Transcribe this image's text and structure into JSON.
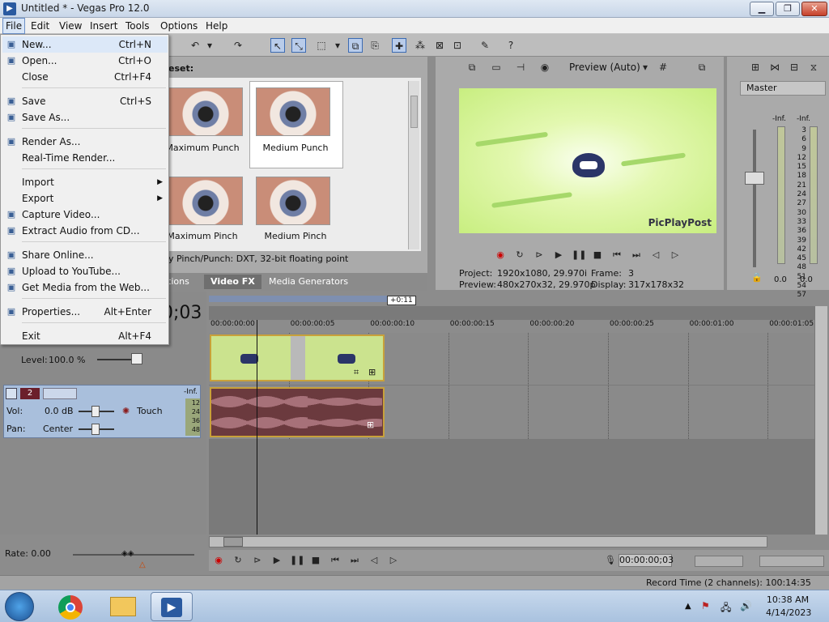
{
  "window": {
    "title": "Untitled * - Vegas Pro 12.0",
    "app_icon": "vegas-icon"
  },
  "menubar": [
    "File",
    "Edit",
    "View",
    "Insert",
    "Tools",
    "Options",
    "Help"
  ],
  "file_menu": {
    "items": [
      {
        "label": "New...",
        "shortcut": "Ctrl+N",
        "icon": "new-file-icon"
      },
      {
        "label": "Open...",
        "shortcut": "Ctrl+O",
        "icon": "open-folder-icon"
      },
      {
        "label": "Close",
        "shortcut": "Ctrl+F4",
        "icon": ""
      },
      {
        "label": "Save",
        "shortcut": "Ctrl+S",
        "icon": "save-icon"
      },
      {
        "label": "Save As...",
        "shortcut": "",
        "icon": "save-as-icon"
      },
      {
        "label": "Render As...",
        "shortcut": "",
        "icon": "render-icon"
      },
      {
        "label": "Real-Time Render...",
        "shortcut": "",
        "icon": ""
      },
      {
        "label": "Import",
        "shortcut": "",
        "icon": ""
      },
      {
        "label": "Export",
        "shortcut": "",
        "icon": ""
      },
      {
        "label": "Capture Video...",
        "shortcut": "",
        "icon": "capture-icon"
      },
      {
        "label": "Extract Audio from CD...",
        "shortcut": "",
        "icon": "cd-icon"
      },
      {
        "label": "Share Online...",
        "shortcut": "",
        "icon": "share-icon"
      },
      {
        "label": "Upload to YouTube...",
        "shortcut": "",
        "icon": "youtube-icon"
      },
      {
        "label": "Get Media from the Web...",
        "shortcut": "",
        "icon": "web-icon"
      },
      {
        "label": "Properties...",
        "shortcut": "Alt+Enter",
        "icon": "properties-icon"
      },
      {
        "label": "Exit",
        "shortcut": "Alt+F4",
        "icon": ""
      }
    ]
  },
  "fx_panel": {
    "header": "eset:",
    "presets": [
      "Maximum Punch",
      "Medium Punch",
      "Maximum Pinch",
      "Medium Pinch"
    ],
    "description": "y Pinch/Punch: DXT, 32-bit floating point",
    "tabs": [
      "itions",
      "Video FX",
      "Media Generators"
    ]
  },
  "preview": {
    "mode": "Preview (Auto)",
    "watermark": "PicPlayPost",
    "project_label": "Project:",
    "project_value": "1920x1080, 29.970i",
    "preview_label": "Preview:",
    "preview_value": "480x270x32, 29.970p",
    "frame_label": "Frame:",
    "frame_value": "3",
    "display_label": "Display:",
    "display_value": "317x178x32"
  },
  "master": {
    "label": "Master",
    "left_peak": "-Inf.",
    "right_peak": "-Inf.",
    "scale": [
      "3",
      "6",
      "9",
      "12",
      "15",
      "18",
      "21",
      "24",
      "27",
      "30",
      "33",
      "36",
      "39",
      "42",
      "45",
      "48",
      "51",
      "54",
      "57"
    ],
    "left_value": "0.0",
    "right_value": "0.0"
  },
  "timeline": {
    "time_display": "0;03",
    "region_marker": "+0:11",
    "ruler_ticks": [
      "00:00:00:00",
      "00:00:00:05",
      "00:00:00:10",
      "00:00:00:15",
      "00:00:00:20",
      "00:00:00:25",
      "00:00:01:00",
      "00:00:01:05"
    ],
    "track1": {
      "level_label": "Level:",
      "level_value": "100.0 %"
    },
    "track2": {
      "number": "2",
      "vol_label": "Vol:",
      "vol_value": "0.0 dB",
      "pan_label": "Pan:",
      "pan_value": "Center",
      "automation": "Touch",
      "peak": "-Inf.",
      "scale": [
        "12",
        "24",
        "36",
        "48"
      ]
    }
  },
  "transport": {
    "rate_label": "Rate: 0.00",
    "time": "00:00:00;03",
    "record_time": "Record Time (2 channels): 100:14:35"
  },
  "taskbar": {
    "time": "10:38 AM",
    "date": "4/14/2023"
  }
}
